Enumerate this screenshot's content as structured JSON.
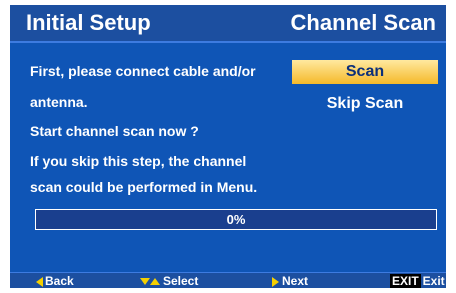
{
  "header": {
    "title_left": "Initial Setup",
    "title_right": "Channel Scan"
  },
  "message": {
    "lines": [
      "First, please connect cable and/or",
      "antenna.",
      "Start channel scan now ?",
      "If you skip this step, the channel",
      "scan could be performed in Menu."
    ]
  },
  "options": [
    {
      "label": "Scan",
      "selected": true
    },
    {
      "label": "Skip Scan",
      "selected": false
    }
  ],
  "progress": {
    "label": "0%",
    "value": 0
  },
  "footer": {
    "back": "Back",
    "select": "Select",
    "next": "Next",
    "exit_key": "EXIT",
    "exit": "Exit"
  },
  "colors": {
    "background": "#0f55b6",
    "accent": "#f5b92a",
    "icon": "#f5d000"
  }
}
